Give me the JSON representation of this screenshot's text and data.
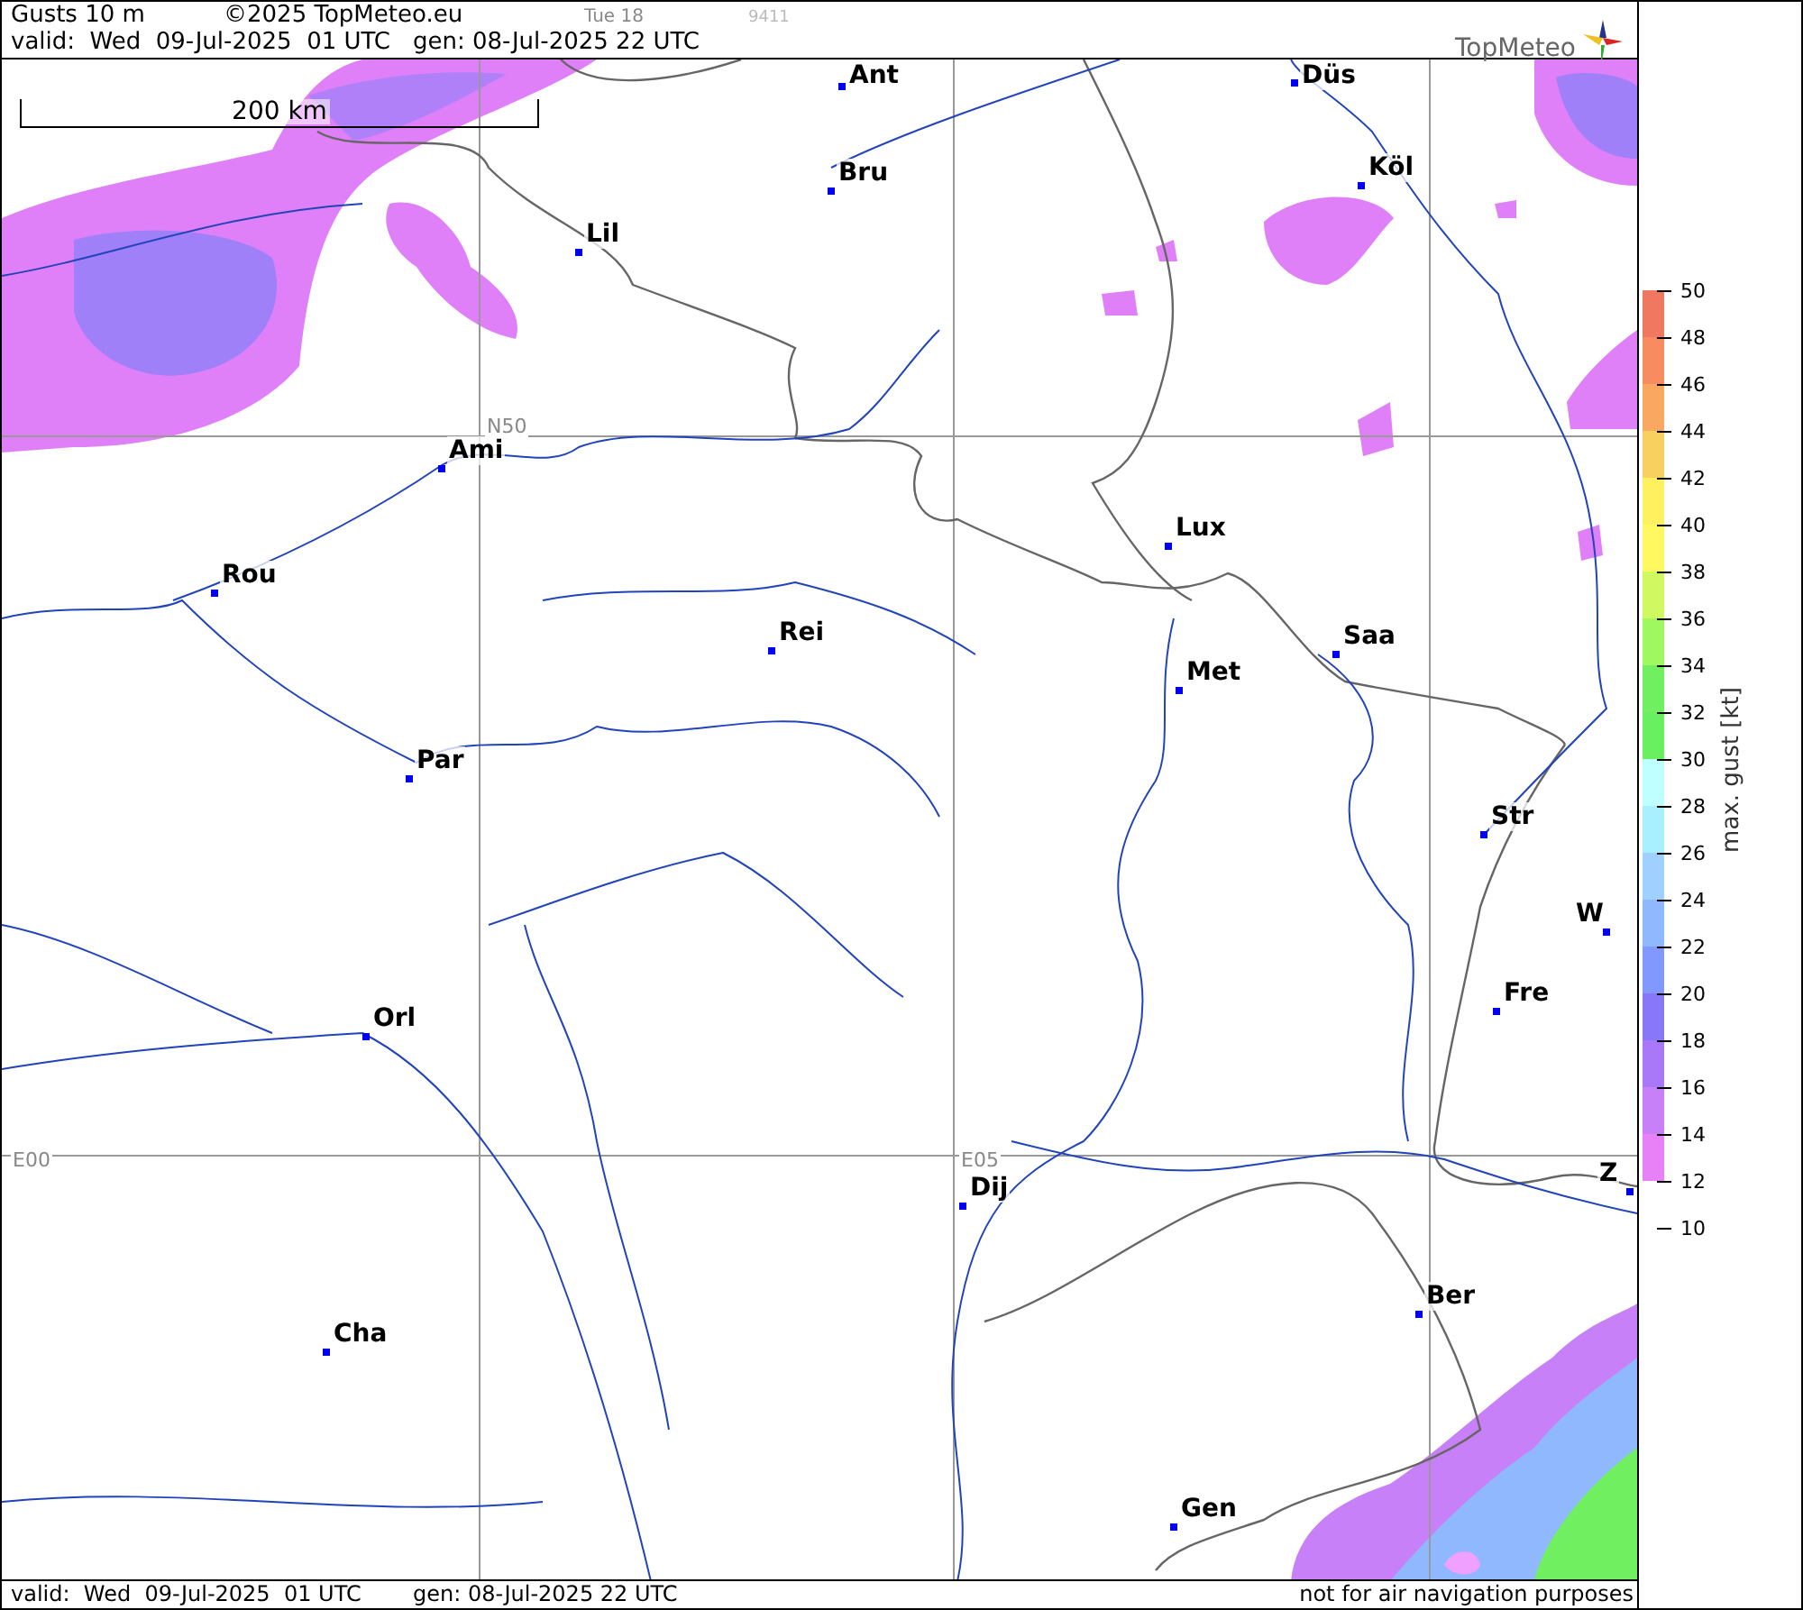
{
  "header": {
    "title": "Gusts 10 m",
    "copyright": "©2025 TopMeteo.eu",
    "run": "Tue 18",
    "code": "9411",
    "valid": "valid:  Wed  09-Jul-2025  01 UTC",
    "generated": "gen: 08-Jul-2025 22 UTC",
    "logo": "TopMeteo"
  },
  "map": {
    "scale": "200 km",
    "grid_labels": [
      "N50",
      "E00",
      "E05"
    ],
    "cities": [
      {
        "name": "Ant"
      },
      {
        "name": "Düs"
      },
      {
        "name": "Bru"
      },
      {
        "name": "Köl"
      },
      {
        "name": "Lil"
      },
      {
        "name": "Ami"
      },
      {
        "name": "Rou"
      },
      {
        "name": "Lux"
      },
      {
        "name": "Rei"
      },
      {
        "name": "Saa"
      },
      {
        "name": "Met"
      },
      {
        "name": "Par"
      },
      {
        "name": "Str"
      },
      {
        "name": "W"
      },
      {
        "name": "Fre"
      },
      {
        "name": "Orl"
      },
      {
        "name": "Z"
      },
      {
        "name": "Dij"
      },
      {
        "name": "Ber"
      },
      {
        "name": "Cha"
      },
      {
        "name": "Gen"
      }
    ]
  },
  "legend": {
    "title": "max. gust [kt]",
    "bands": [
      {
        "color": "#f07860"
      },
      {
        "color": "#f88c60"
      },
      {
        "color": "#f8a860"
      },
      {
        "color": "#f8d060"
      },
      {
        "color": "#fff060"
      },
      {
        "color": "#fff860"
      },
      {
        "color": "#d0f860"
      },
      {
        "color": "#a0f860"
      },
      {
        "color": "#70f060"
      },
      {
        "color": "#68f060"
      },
      {
        "color": "#c0ffff"
      },
      {
        "color": "#a8f0ff"
      },
      {
        "color": "#a0d0ff"
      },
      {
        "color": "#90b8ff"
      },
      {
        "color": "#8098ff"
      },
      {
        "color": "#8878f8"
      },
      {
        "color": "#a878f8"
      },
      {
        "color": "#c880f8"
      },
      {
        "color": "#e880f8"
      }
    ],
    "ticks": [
      "50",
      "48",
      "46",
      "44",
      "42",
      "40",
      "38",
      "36",
      "34",
      "32",
      "30",
      "28",
      "26",
      "24",
      "22",
      "20",
      "18",
      "16",
      "14",
      "12",
      "10"
    ]
  },
  "footer": {
    "valid": "valid:  Wed  09-Jul-2025  01 UTC",
    "generated": "gen: 08-Jul-2025 22 UTC",
    "note": "not for air navigation purposes"
  }
}
